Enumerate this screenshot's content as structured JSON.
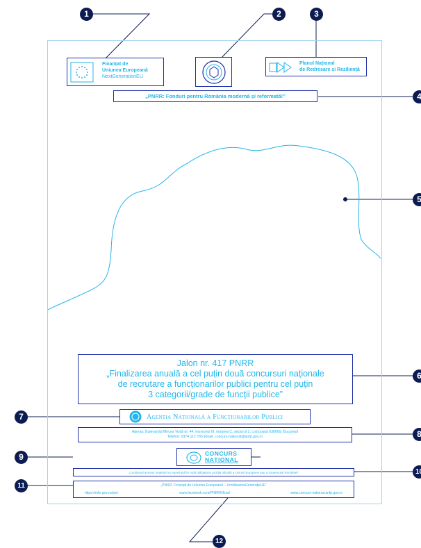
{
  "markers": [
    "1",
    "2",
    "3",
    "4",
    "5",
    "6",
    "7",
    "8",
    "9",
    "10",
    "11",
    "12"
  ],
  "eu_box": {
    "line1": "Finanțat de",
    "line2": "Uniunea Europeană",
    "line3": "NextGenerationEU"
  },
  "pnrr_logo": {
    "line1": "Planul Național",
    "line2": "de Redresare și Reziliență"
  },
  "slogan": "„PNRR: Fonduri pentru România modernă și reformată!”",
  "jalon": {
    "line1": "Jalon nr. 417 PNRR",
    "line2": "„Finalizarea anuală a cel puțin două concursuri naționale",
    "line3": "de recrutare a funcționarilor publici pentru cel puțin",
    "line4": "3 categorii/grade de funcții publice”"
  },
  "agency": "Agenția Națională a Funcționarilor Publici",
  "address": {
    "line1": "Adresa: Bulevardul Mircea Vodă nr. 44, tronsonul III, intrarea C, sectorul 3, cod poștal 030669, București",
    "line2": "Telefon: 0374 112 765    Email: concurs-national@anfp.gov.ro"
  },
  "concurs_logo": {
    "line1": "CONCURS",
    "line2": "NAȚIONAL"
  },
  "disclaimer": "„Conținutul acestui material nu reprezintă în mod obligatoriu poziția oficială a Uniunii Europene sau a Guvernului României”",
  "footer": {
    "title": "„PNRR. Finanțat de Uniunea Europeană – UrmătoareaGenerațieUE”",
    "links": [
      "https://mfe.gov.ro/pnrr",
      "www.facebook.com/PNRROficial",
      "www.concurs-national.anfp.gov.ro"
    ]
  },
  "colors": {
    "accent": "#22b6ea",
    "frame": "#1e2ea8",
    "marker": "#0c1c52"
  }
}
